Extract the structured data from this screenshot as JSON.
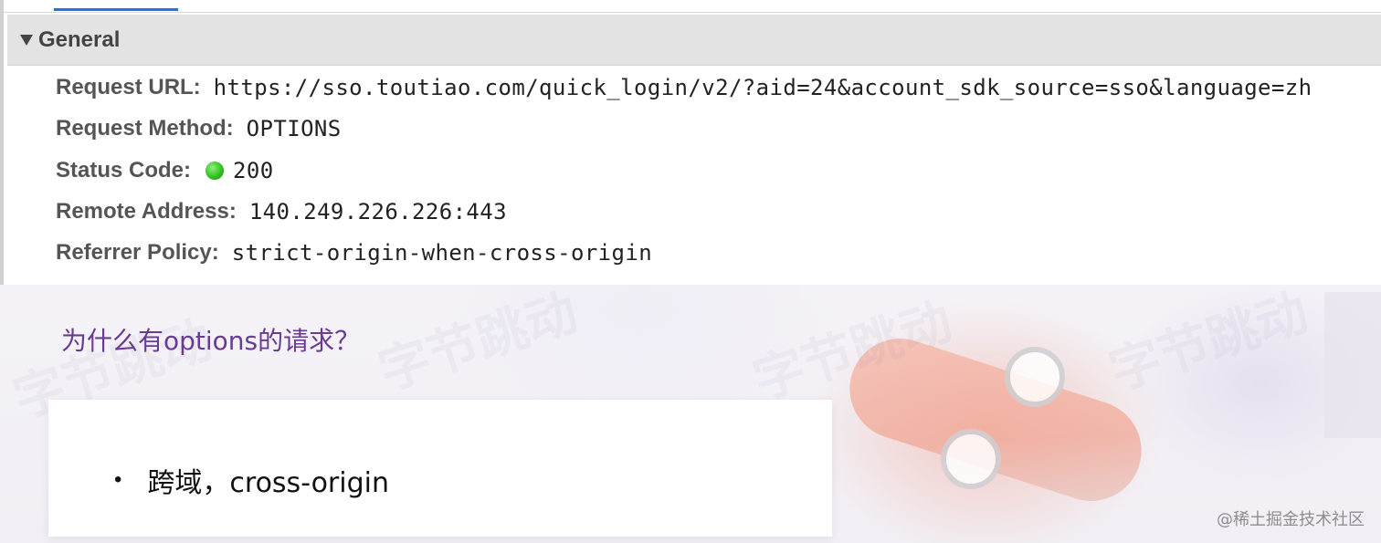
{
  "devtools": {
    "section_title": "General",
    "fields": {
      "request_url": {
        "label": "Request URL:",
        "value": "https://sso.toutiao.com/quick_login/v2/?aid=24&account_sdk_source=sso&language=zh"
      },
      "request_method": {
        "label": "Request Method:",
        "value": "OPTIONS"
      },
      "status_code": {
        "label": "Status Code:",
        "value": "200",
        "status_color": "#2fc21f"
      },
      "remote_address": {
        "label": "Remote Address:",
        "value": "140.249.226.226:443"
      },
      "referrer_policy": {
        "label": "Referrer Policy:",
        "value": "strict-origin-when-cross-origin"
      }
    },
    "accent_color": "#1a73e8"
  },
  "slide": {
    "question": "为什么有options的请求？",
    "question_color": "#6a3b95",
    "bullet": "跨域，cross-origin",
    "bullet_marker": "•",
    "credit": "@稀土掘金技术社区",
    "watermark": "字节跳动"
  }
}
